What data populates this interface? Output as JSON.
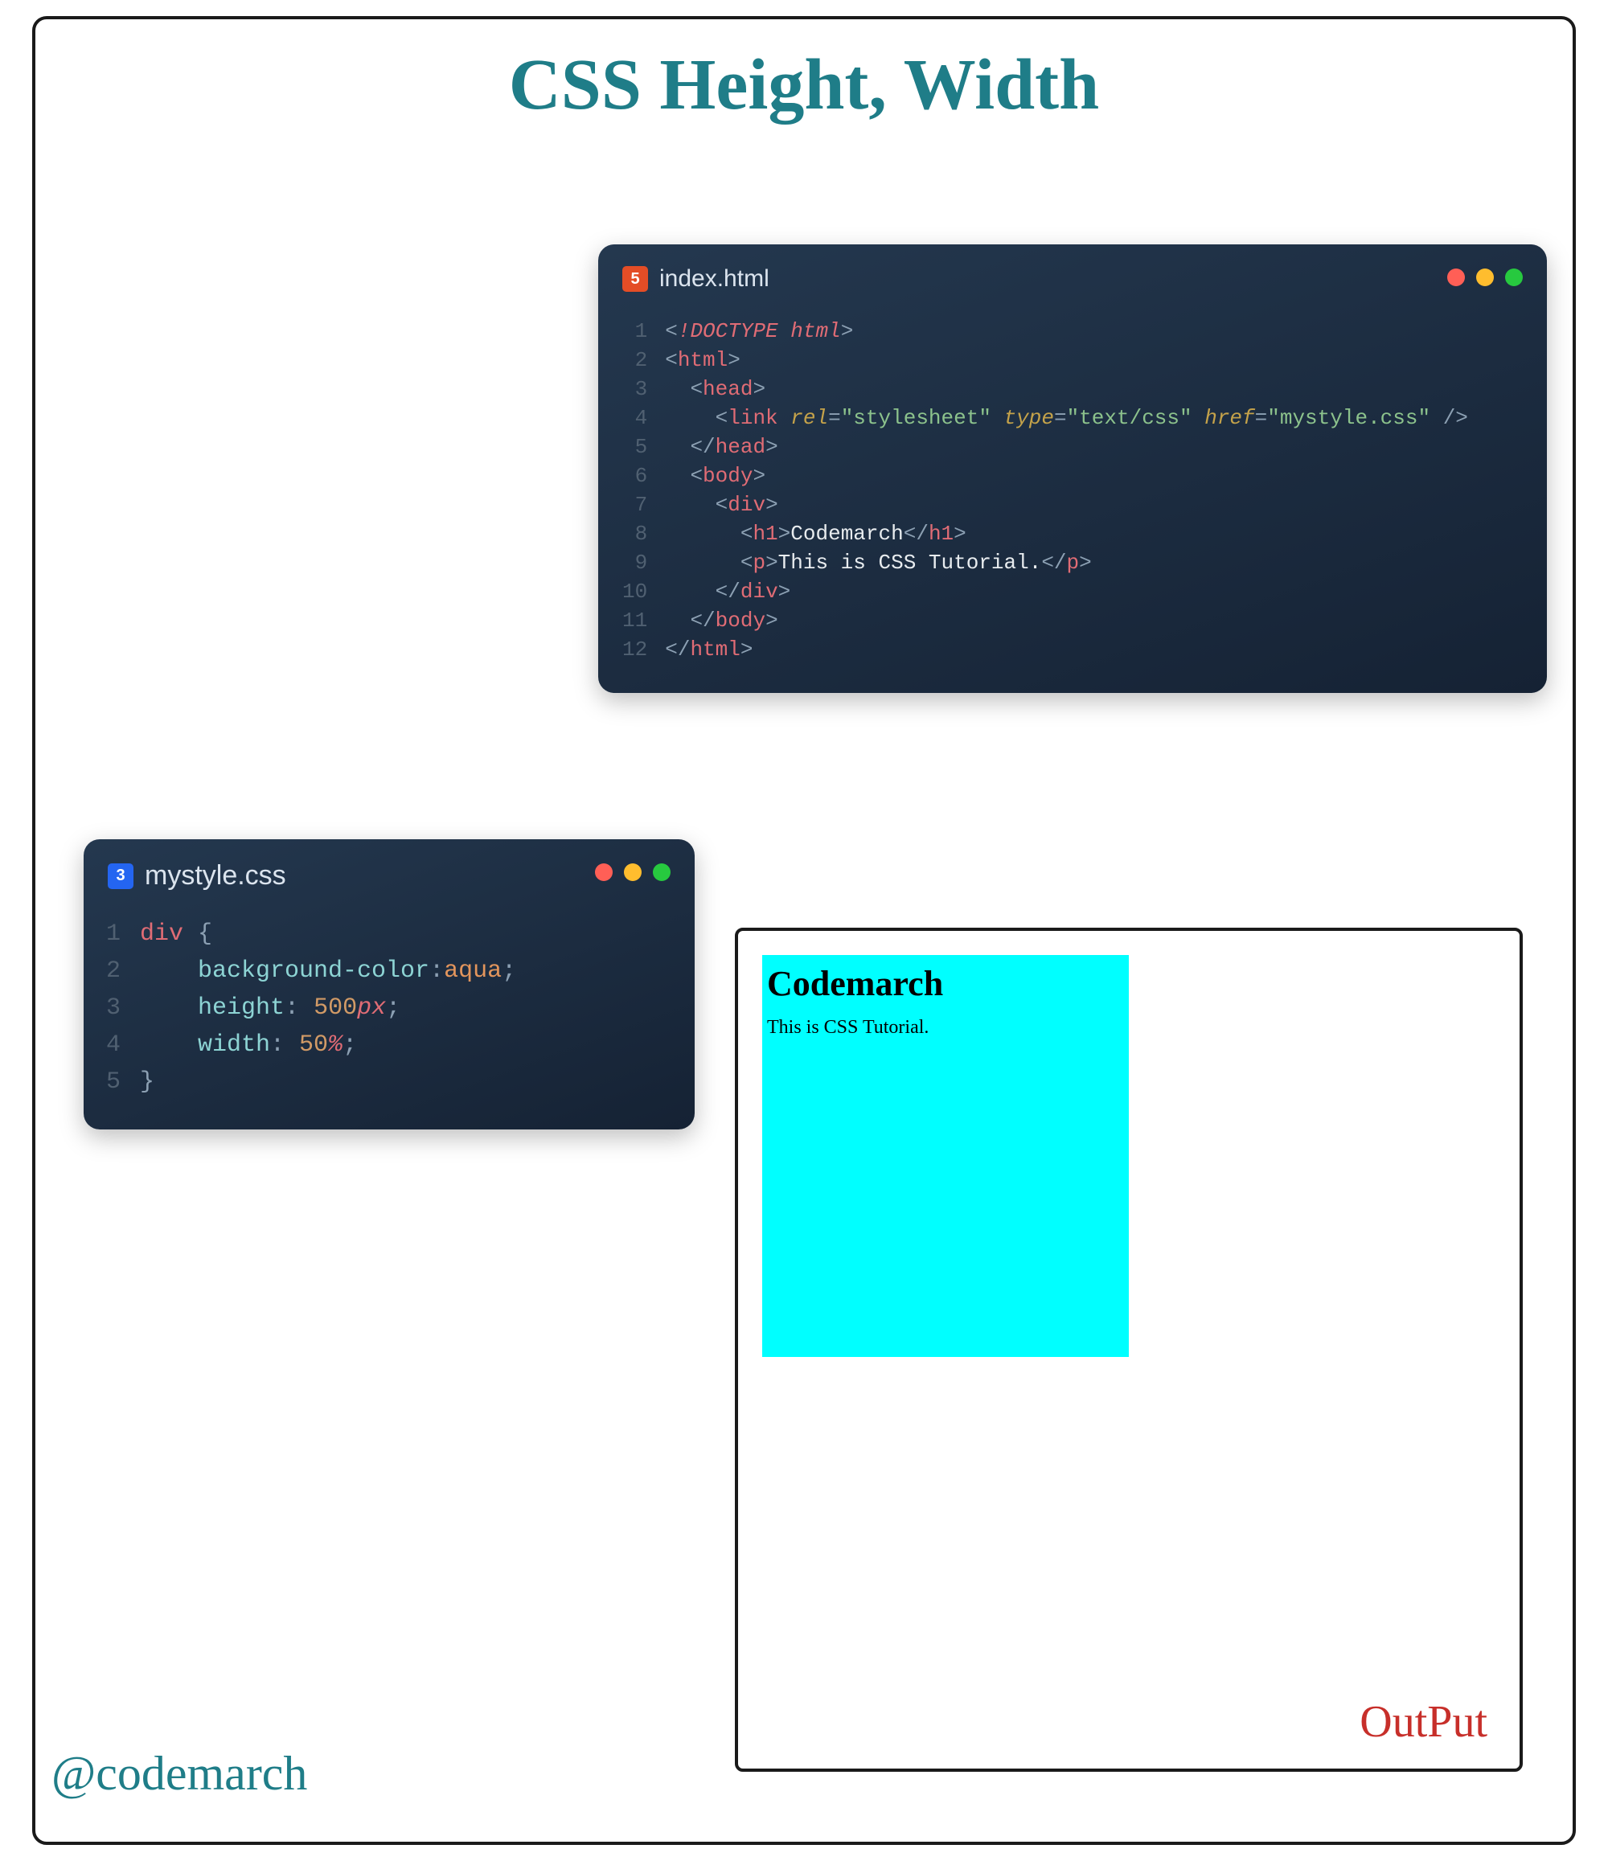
{
  "title": "CSS Height, Width",
  "handle": "@codemarch",
  "editor_html": {
    "filename": "index.html",
    "icon": "html5-icon",
    "lines": {
      "l1": {
        "n": "1",
        "doctype_bang": "!",
        "doctype_kw": "DOCTYPE",
        "doctype_val": "html"
      },
      "l2": {
        "n": "2",
        "tag": "html"
      },
      "l3": {
        "n": "3",
        "tag": "head"
      },
      "l4": {
        "n": "4",
        "tag": "link",
        "attr1": "rel",
        "val1": "\"stylesheet\"",
        "attr2": "type",
        "val2": "\"text/css\"",
        "attr3": "href",
        "val3": "\"mystyle.css\""
      },
      "l5": {
        "n": "5",
        "tag": "head"
      },
      "l6": {
        "n": "6",
        "tag": "body"
      },
      "l7": {
        "n": "7",
        "tag": "div"
      },
      "l8": {
        "n": "8",
        "tag": "h1",
        "text": "Codemarch"
      },
      "l9": {
        "n": "9",
        "tag": "p",
        "text": "This is CSS Tutorial."
      },
      "l10": {
        "n": "10",
        "tag": "div"
      },
      "l11": {
        "n": "11",
        "tag": "body"
      },
      "l12": {
        "n": "12",
        "tag": "html"
      }
    }
  },
  "editor_css": {
    "filename": "mystyle.css",
    "icon": "css3-icon",
    "lines": {
      "l1": {
        "n": "1",
        "sel": "div",
        "brace": "{"
      },
      "l2": {
        "n": "2",
        "prop": "background-color",
        "valkw": "aqua"
      },
      "l3": {
        "n": "3",
        "prop": "height",
        "num": "500",
        "unit": "px"
      },
      "l4": {
        "n": "4",
        "prop": "width",
        "num": "50",
        "unit": "%"
      },
      "l5": {
        "n": "5",
        "brace": "}"
      }
    }
  },
  "output": {
    "heading": "Codemarch",
    "paragraph": "This is CSS Tutorial.",
    "label": "OutPut"
  }
}
